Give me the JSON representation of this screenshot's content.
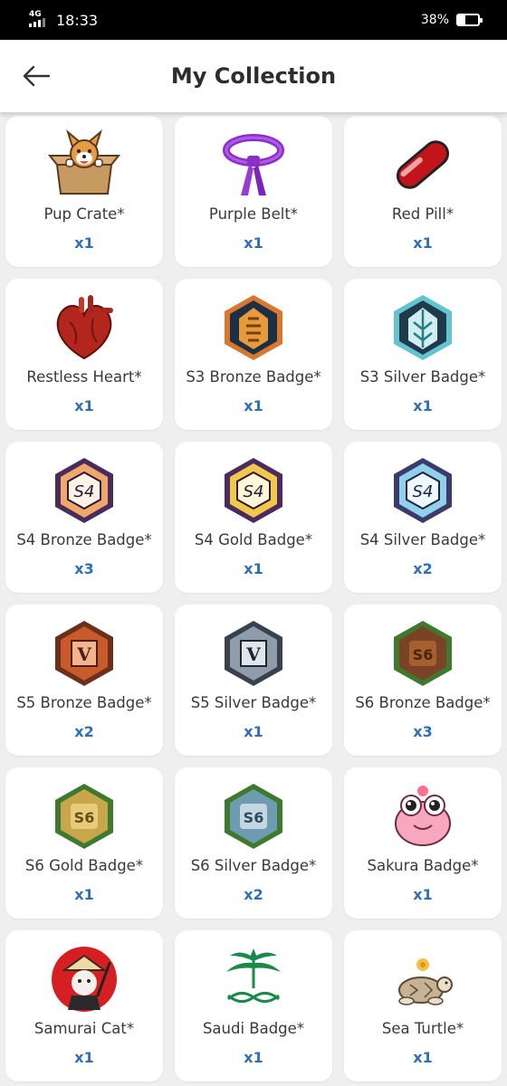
{
  "status_bar": {
    "network": "4G",
    "time": "18:33",
    "battery_text": "38%",
    "battery_level": 0.38
  },
  "header": {
    "title": "My Collection",
    "back_icon": "arrow-left-icon"
  },
  "colors": {
    "quantity": "#2f6fb3",
    "card": "#ffffff",
    "background": "#efefef"
  },
  "items": [
    {
      "name": "Pup Crate*",
      "qty": "x1",
      "icon": "pup-crate-icon"
    },
    {
      "name": "Purple Belt*",
      "qty": "x1",
      "icon": "purple-belt-icon"
    },
    {
      "name": "Red Pill*",
      "qty": "x1",
      "icon": "red-pill-icon"
    },
    {
      "name": "Restless Heart*",
      "qty": "x1",
      "icon": "restless-heart-icon"
    },
    {
      "name": "S3 Bronze Badge*",
      "qty": "x1",
      "icon": "s3-bronze-badge-icon"
    },
    {
      "name": "S3 Silver Badge*",
      "qty": "x1",
      "icon": "s3-silver-badge-icon"
    },
    {
      "name": "S4 Bronze Badge*",
      "qty": "x3",
      "icon": "s4-bronze-badge-icon"
    },
    {
      "name": "S4 Gold Badge*",
      "qty": "x1",
      "icon": "s4-gold-badge-icon"
    },
    {
      "name": "S4 Silver Badge*",
      "qty": "x2",
      "icon": "s4-silver-badge-icon"
    },
    {
      "name": "S5 Bronze Badge*",
      "qty": "x2",
      "icon": "s5-bronze-badge-icon"
    },
    {
      "name": "S5 Silver Badge*",
      "qty": "x1",
      "icon": "s5-silver-badge-icon"
    },
    {
      "name": "S6 Bronze Badge*",
      "qty": "x3",
      "icon": "s6-bronze-badge-icon"
    },
    {
      "name": "S6 Gold Badge*",
      "qty": "x1",
      "icon": "s6-gold-badge-icon"
    },
    {
      "name": "S6 Silver Badge*",
      "qty": "x2",
      "icon": "s6-silver-badge-icon"
    },
    {
      "name": "Sakura Badge*",
      "qty": "x1",
      "icon": "sakura-badge-icon"
    },
    {
      "name": "Samurai Cat*",
      "qty": "x1",
      "icon": "samurai-cat-icon"
    },
    {
      "name": "Saudi Badge*",
      "qty": "x1",
      "icon": "saudi-badge-icon"
    },
    {
      "name": "Sea Turtle*",
      "qty": "x1",
      "icon": "sea-turtle-icon"
    }
  ]
}
